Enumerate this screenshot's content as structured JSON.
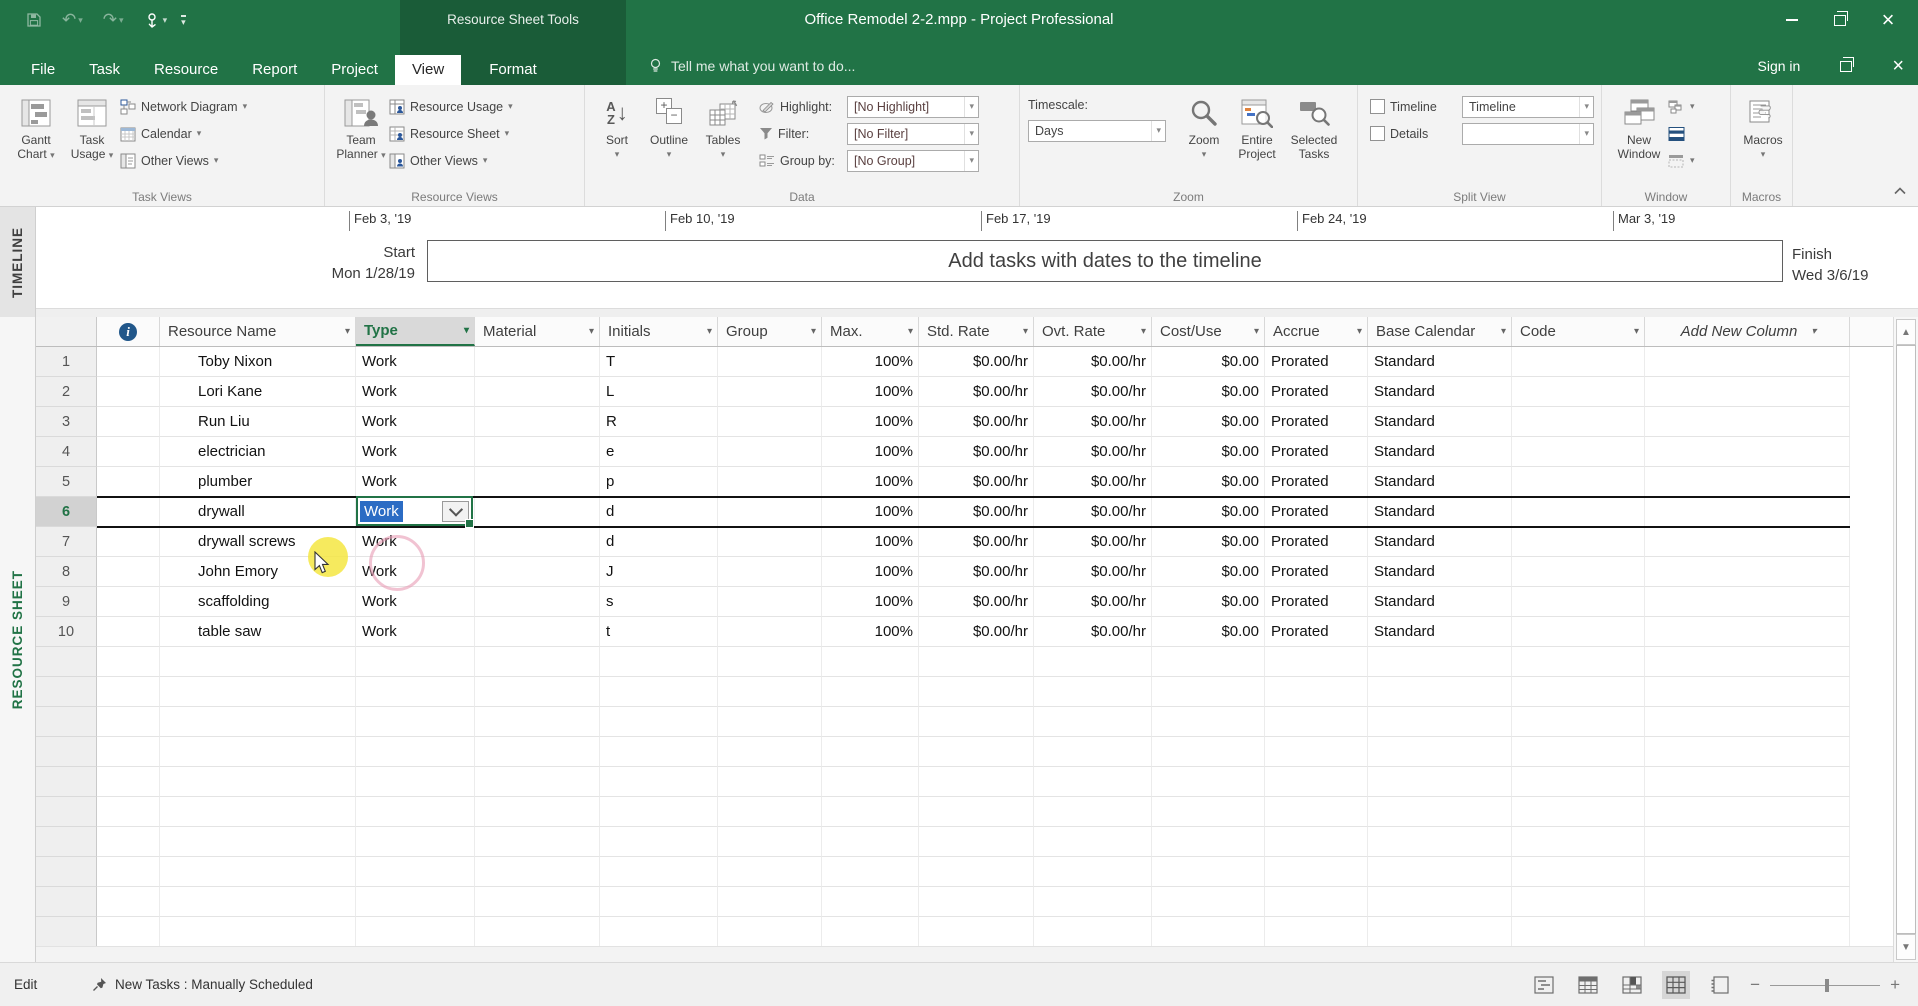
{
  "titlebar": {
    "title": "Office Remodel 2-2.mpp - Project Professional",
    "contextual_tool": "Resource Sheet Tools",
    "sign_in": "Sign in",
    "tell_me": "Tell me what you want to do..."
  },
  "tabs": [
    "File",
    "Task",
    "Resource",
    "Report",
    "Project",
    "View",
    "Format"
  ],
  "active_tab": "View",
  "ribbon": {
    "task_views": {
      "label": "Task Views",
      "gantt_chart_line1": "Gantt",
      "gantt_chart_line2": "Chart",
      "task_usage_line1": "Task",
      "task_usage_line2": "Usage",
      "network_diagram": "Network Diagram",
      "calendar": "Calendar",
      "other_views": "Other Views"
    },
    "resource_views": {
      "label": "Resource Views",
      "team_planner_line1": "Team",
      "team_planner_line2": "Planner",
      "resource_usage": "Resource Usage",
      "resource_sheet": "Resource Sheet",
      "other_views": "Other Views"
    },
    "data": {
      "label": "Data",
      "sort": "Sort",
      "outline": "Outline",
      "tables": "Tables",
      "highlight_label": "Highlight:",
      "highlight_value": "[No Highlight]",
      "filter_label": "Filter:",
      "filter_value": "[No Filter]",
      "group_by_label": "Group by:",
      "group_by_value": "[No Group]"
    },
    "zoom": {
      "label": "Zoom",
      "timescale_label": "Timescale:",
      "timescale_value": "Days",
      "zoom": "Zoom",
      "entire_project_line1": "Entire",
      "entire_project_line2": "Project",
      "selected_tasks_line1": "Selected",
      "selected_tasks_line2": "Tasks"
    },
    "split_view": {
      "label": "Split View",
      "timeline": "Timeline",
      "timeline_value": "Timeline",
      "details": "Details",
      "details_value": ""
    },
    "window": {
      "label": "Window",
      "new_window_line1": "New",
      "new_window_line2": "Window"
    },
    "macros": {
      "label": "Macros",
      "macros": "Macros"
    }
  },
  "timeline": {
    "pane_label": "TIMELINE",
    "dates": [
      "Feb 3, '19",
      "Feb 10, '19",
      "Feb 17, '19",
      "Feb 24, '19",
      "Mar 3, '19"
    ],
    "start_label": "Start",
    "start_date": "Mon 1/28/19",
    "finish_label": "Finish",
    "finish_date": "Wed 3/6/19",
    "placeholder": "Add tasks with dates to the timeline"
  },
  "sheet": {
    "pane_label": "RESOURCE SHEET",
    "columns": [
      "Resource Name",
      "Type",
      "Material",
      "Initials",
      "Group",
      "Max.",
      "Std. Rate",
      "Ovt. Rate",
      "Cost/Use",
      "Accrue",
      "Base Calendar",
      "Code",
      "Add New Column"
    ],
    "selected_column": "Type",
    "selected_row": "6",
    "edit_cell_value": "Work",
    "rows": [
      {
        "num": "1",
        "name": "Toby Nixon",
        "type": "Work",
        "initials": "T",
        "max": "100%",
        "std_rate": "$0.00/hr",
        "ovt_rate": "$0.00/hr",
        "cost_use": "$0.00",
        "accrue": "Prorated",
        "base_calendar": "Standard"
      },
      {
        "num": "2",
        "name": "Lori Kane",
        "type": "Work",
        "initials": "L",
        "max": "100%",
        "std_rate": "$0.00/hr",
        "ovt_rate": "$0.00/hr",
        "cost_use": "$0.00",
        "accrue": "Prorated",
        "base_calendar": "Standard"
      },
      {
        "num": "3",
        "name": "Run Liu",
        "type": "Work",
        "initials": "R",
        "max": "100%",
        "std_rate": "$0.00/hr",
        "ovt_rate": "$0.00/hr",
        "cost_use": "$0.00",
        "accrue": "Prorated",
        "base_calendar": "Standard"
      },
      {
        "num": "4",
        "name": "electrician",
        "type": "Work",
        "initials": "e",
        "max": "100%",
        "std_rate": "$0.00/hr",
        "ovt_rate": "$0.00/hr",
        "cost_use": "$0.00",
        "accrue": "Prorated",
        "base_calendar": "Standard"
      },
      {
        "num": "5",
        "name": "plumber",
        "type": "Work",
        "initials": "p",
        "max": "100%",
        "std_rate": "$0.00/hr",
        "ovt_rate": "$0.00/hr",
        "cost_use": "$0.00",
        "accrue": "Prorated",
        "base_calendar": "Standard"
      },
      {
        "num": "6",
        "name": "drywall",
        "type": "Work",
        "initials": "d",
        "max": "100%",
        "std_rate": "$0.00/hr",
        "ovt_rate": "$0.00/hr",
        "cost_use": "$0.00",
        "accrue": "Prorated",
        "base_calendar": "Standard",
        "selected": true,
        "editing": true
      },
      {
        "num": "7",
        "name": "drywall screws",
        "type": "Work",
        "initials": "d",
        "max": "100%",
        "std_rate": "$0.00/hr",
        "ovt_rate": "$0.00/hr",
        "cost_use": "$0.00",
        "accrue": "Prorated",
        "base_calendar": "Standard"
      },
      {
        "num": "8",
        "name": "John Emory",
        "type": "Work",
        "initials": "J",
        "max": "100%",
        "std_rate": "$0.00/hr",
        "ovt_rate": "$0.00/hr",
        "cost_use": "$0.00",
        "accrue": "Prorated",
        "base_calendar": "Standard"
      },
      {
        "num": "9",
        "name": "scaffolding",
        "type": "Work",
        "initials": "s",
        "max": "100%",
        "std_rate": "$0.00/hr",
        "ovt_rate": "$0.00/hr",
        "cost_use": "$0.00",
        "accrue": "Prorated",
        "base_calendar": "Standard"
      },
      {
        "num": "10",
        "name": "table saw",
        "type": "Work",
        "initials": "t",
        "max": "100%",
        "std_rate": "$0.00/hr",
        "ovt_rate": "$0.00/hr",
        "cost_use": "$0.00",
        "accrue": "Prorated",
        "base_calendar": "Standard"
      }
    ]
  },
  "statusbar": {
    "mode": "Edit",
    "new_tasks": "New Tasks : Manually Scheduled"
  },
  "icons": {
    "dropdown": "▾",
    "scroll_up": "▲",
    "scroll_down": "▼",
    "close": "×",
    "minimize": "–",
    "undo": "↶",
    "redo": "↷",
    "info": "i",
    "sort_arrow": "↓",
    "zoom_out": "−",
    "zoom_in": "+"
  },
  "colors": {
    "accent_green": "#217346",
    "contextual_green": "#1a5c38",
    "selection_blue": "#2b6cc4",
    "click_highlight_yellow": "#f5e642",
    "click_ring_pink": "#e89bb4"
  }
}
